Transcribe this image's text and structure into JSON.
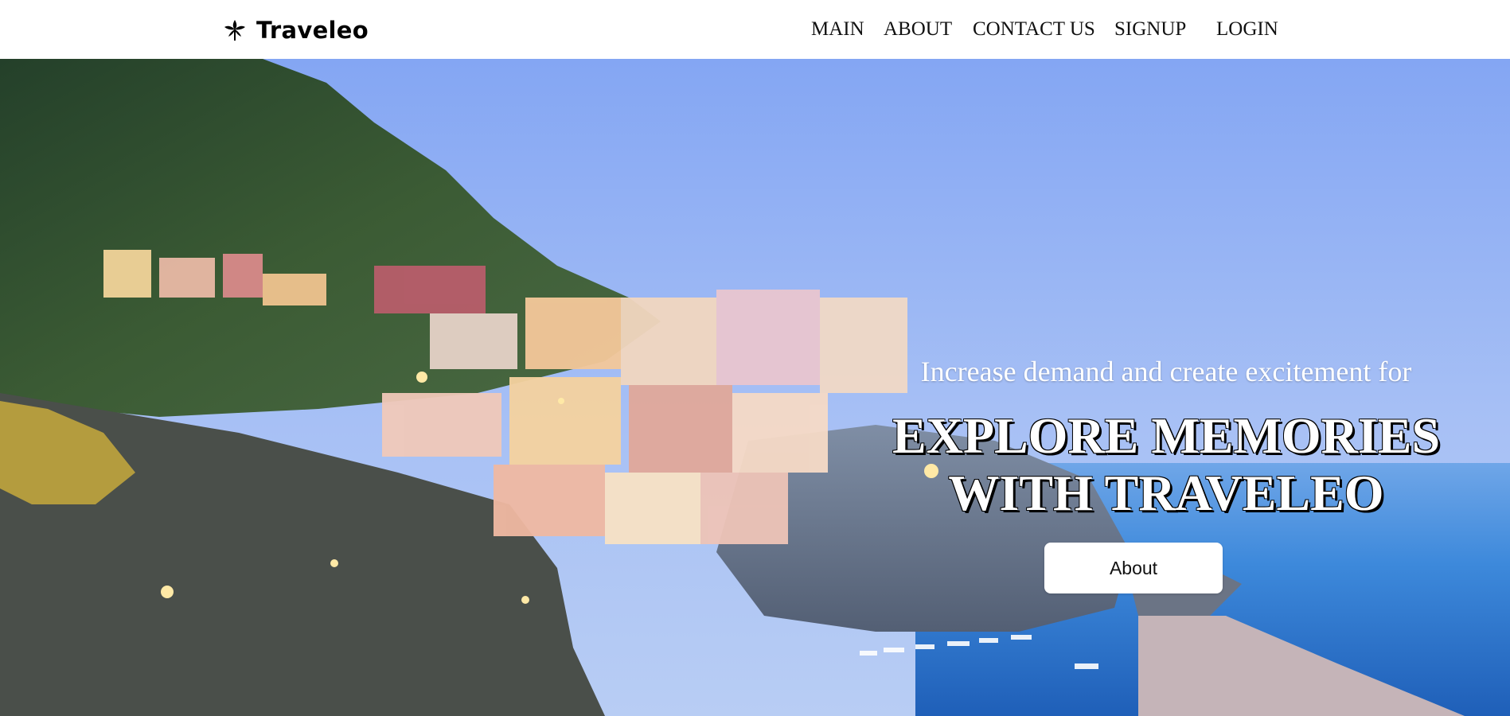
{
  "navbar": {
    "brand": {
      "icon": "leaf-icon",
      "name": "Traveleo"
    },
    "links": [
      "MAIN",
      "ABOUT",
      "CONTACT US",
      "SIGNUP",
      "LOGIN"
    ]
  },
  "hero": {
    "image": "cliffside-coastal-village-at-dusk",
    "tagline": "Increase demand and create excitement for",
    "headline_line1": "EXPLORE MEMORIES",
    "headline_line2": "WITH TRAVELEO",
    "button_label": "About"
  },
  "colors": {
    "navbar_bg": "#ffffff",
    "sky_top": "#7a9ef0",
    "sea": "#2f7fd6",
    "text_light": "#ffffff",
    "button_bg": "#ffffff"
  }
}
